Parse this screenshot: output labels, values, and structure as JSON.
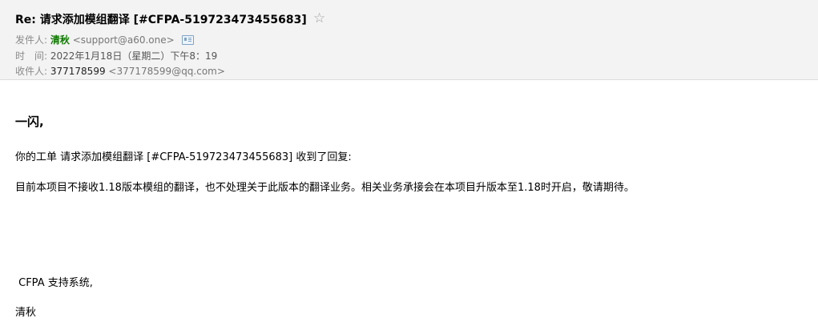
{
  "email": {
    "subject": "Re: 请求添加模组翻译 [#CFPA-519723473455683]",
    "star_icon": "star-outline-icon",
    "from_label": "发件人:",
    "from_name": "清秋",
    "from_address": "<support@a60.one>",
    "contact_card_icon": "contact-card-icon",
    "time_label": "时　间:",
    "time_value": "2022年1月18日（星期二）下午8：19",
    "to_label": "收件人:",
    "to_name": "377178599",
    "to_address": "<377178599@qq.com>"
  },
  "content": {
    "greeting": "一闪,",
    "line1": "你的工单 请求添加模组翻译 [#CFPA-519723473455683] 收到了回复:",
    "line2": "目前本项目不接收1.18版本模组的翻译，也不处理关于此版本的翻译业务。相关业务承接会在本项目升版本至1.18时开启，敬请期待。",
    "signature_org": " CFPA 支持系统,",
    "signature_name": "清秋"
  },
  "colors": {
    "header_bg": "#f3f3f3",
    "sender_name": "#0f7a00",
    "star": "#a0a0a0"
  }
}
